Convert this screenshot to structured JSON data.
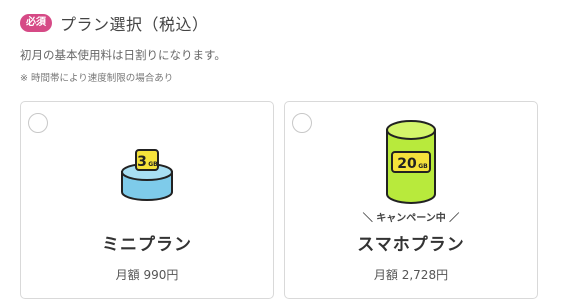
{
  "header": {
    "badge": "必須",
    "title": "プラン選択（税込）"
  },
  "description": "初月の基本使用料は日割りになります。",
  "note": "※ 時間帯により速度制限の場合あり",
  "plans": [
    {
      "name": "ミニプラン",
      "price": "月額 990円",
      "data_label": "3GB",
      "data_value": "3",
      "unit": "GB",
      "selected": false,
      "icon": "small-data-cylinder-icon",
      "color": "#7ecbea"
    },
    {
      "name": "スマホプラン",
      "price": "月額 2,728円",
      "data_label": "20GB",
      "data_value": "20",
      "unit": "GB",
      "campaign": "＼ キャンペーン中 ／",
      "selected": false,
      "icon": "large-data-cylinder-icon",
      "color": "#b8ea3c"
    }
  ],
  "colors": {
    "badge": "#d64a86",
    "mini_cylinder": "#7ecbea",
    "sumaho_cylinder": "#b8ea3c",
    "label_yellow": "#f5e23b"
  }
}
